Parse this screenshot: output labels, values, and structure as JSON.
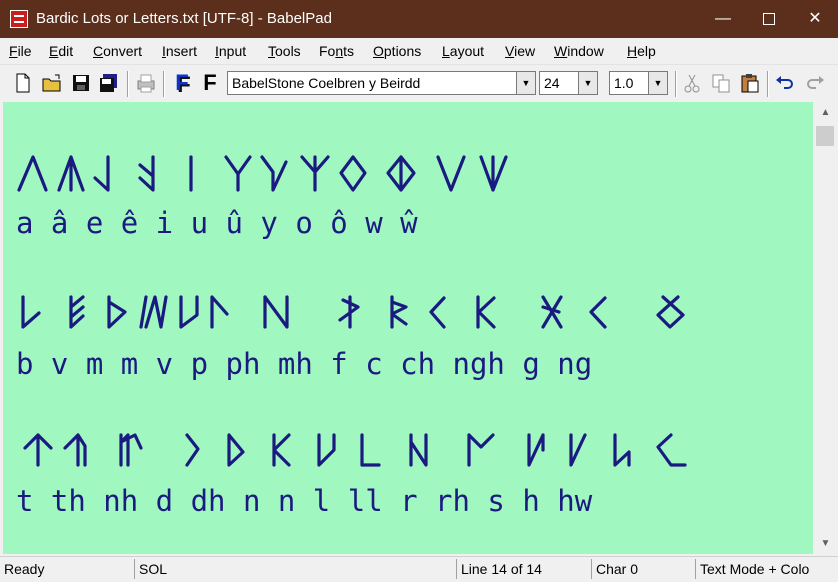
{
  "window": {
    "title": "Bardic Lots or Letters.txt [UTF-8] - BabelPad",
    "minimize_glyph": "—",
    "close_glyph": "✕"
  },
  "menu": [
    {
      "label": "File",
      "accel": "F",
      "rest": "ile"
    },
    {
      "label": "Edit",
      "accel": "E",
      "rest": "dit"
    },
    {
      "label": "Convert",
      "accel": "C",
      "rest": "onvert"
    },
    {
      "label": "Insert",
      "accel": "I",
      "rest": "nsert"
    },
    {
      "label": "Input",
      "accel": "I",
      "rest": "nput"
    },
    {
      "label": "Tools",
      "accel": "T",
      "rest": "ools"
    },
    {
      "label": "Fonts",
      "pre": "Fo",
      "accel": "n",
      "rest": "ts"
    },
    {
      "label": "Options",
      "accel": "O",
      "rest": "ptions"
    },
    {
      "label": "Layout",
      "accel": "L",
      "rest": "ayout"
    },
    {
      "label": "View",
      "accel": "V",
      "rest": "iew"
    },
    {
      "label": "Window",
      "accel": "W",
      "rest": "indow"
    },
    {
      "label": "Help",
      "accel": "H",
      "rest": "elp"
    }
  ],
  "toolbar": {
    "font_name": "BabelStone Coelbren y Beirdd",
    "font_size": "24",
    "line_spacing": "1.0",
    "icons": [
      "new-file-icon",
      "open-folder-icon",
      "save-icon",
      "save-all-icon",
      "print-icon",
      "font-blue-f-icon",
      "font-black-f-icon",
      "cut-icon",
      "copy-icon",
      "paste-icon",
      "undo-icon",
      "redo-icon"
    ]
  },
  "editor": {
    "colors": {
      "background": "#a0f8c0",
      "text": "#1a1a80"
    },
    "lines": [
      {
        "latin": "a â e ê i u û y o ô w ŵ"
      },
      {
        "latin": "b v m m v p ph mh f c ch ngh g ng"
      },
      {
        "latin": "t th nh d dh n n l ll r rh s h hw"
      }
    ]
  },
  "status": {
    "ready": "Ready",
    "mode": "SOL",
    "line": "Line 14 of 14",
    "char": "Char 0",
    "text_mode": "Text Mode + Colo"
  }
}
